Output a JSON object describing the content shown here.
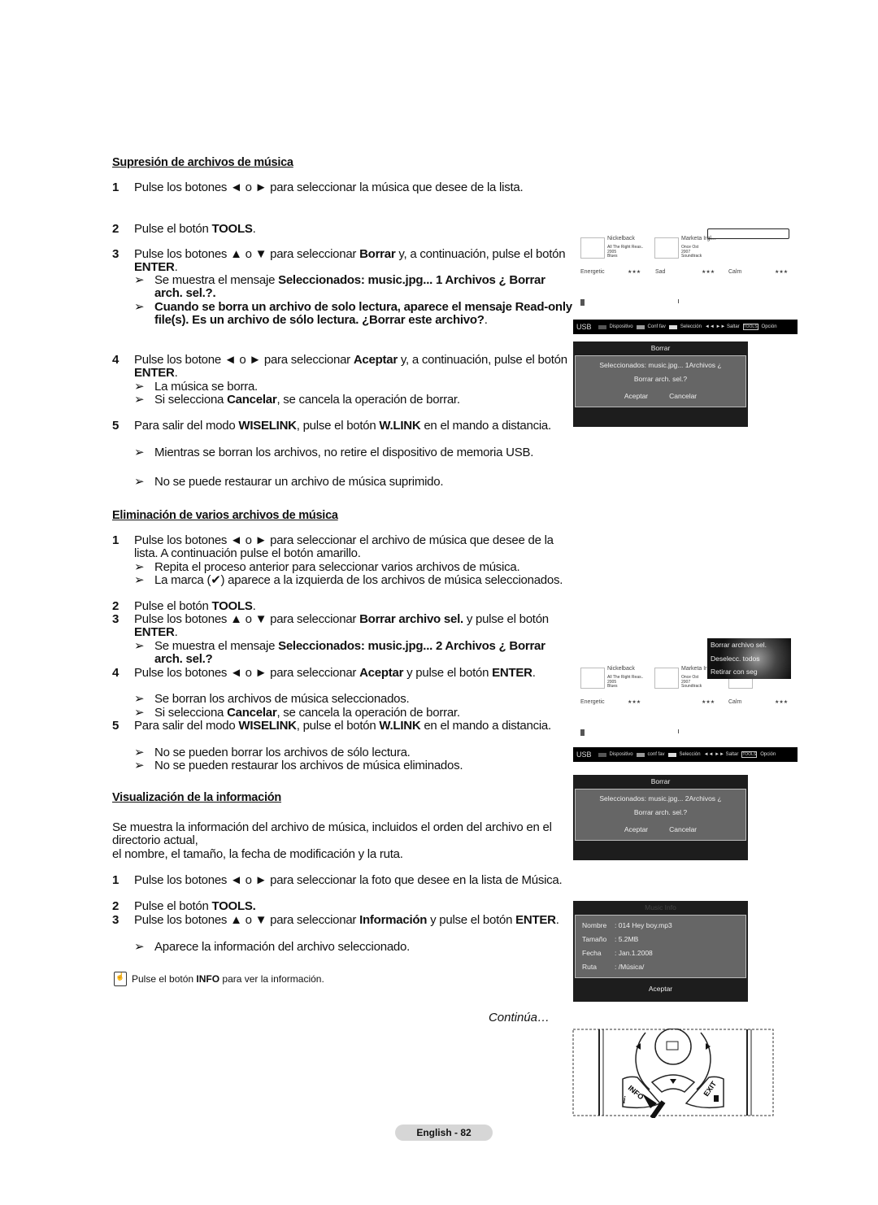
{
  "section1": {
    "title": "Supresión de archivos de música",
    "blocks": [
      {
        "type": "step",
        "num": "1",
        "parts": [
          [
            "Pulse los botones ◄ o ► para seleccionar la música que desee de la lista.",
            0
          ]
        ]
      },
      {
        "type": "step",
        "num": "2",
        "parts": [
          [
            "Pulse el botón ",
            0
          ],
          [
            "TOOLS",
            1
          ],
          [
            ".",
            0
          ]
        ]
      },
      {
        "type": "step",
        "num": "3",
        "parts": [
          [
            "Pulse los botones ▲ o ▼ para seleccionar ",
            0
          ],
          [
            "Borrar",
            1
          ],
          [
            " y, a continuación, pulse el botón ",
            0
          ],
          [
            "ENTER",
            1
          ],
          [
            ".",
            0
          ]
        ]
      },
      {
        "type": "note",
        "parts": [
          [
            "Se muestra el mensaje ",
            0
          ],
          [
            "Seleccionados: music.jpg... 1 Archivos ¿ Borrar arch. sel.?.",
            1
          ]
        ]
      },
      {
        "type": "note",
        "parts": [
          [
            "Cuando se borra un archivo de solo lectura, aparece el mensaje Read-only file(s). Es un archivo de sólo lectura. ¿Borrar este archivo?",
            1
          ],
          [
            ".",
            0
          ]
        ]
      },
      {
        "type": "step",
        "num": "4",
        "parts": [
          [
            "Pulse los botone ◄ o ► para seleccionar ",
            0
          ],
          [
            "Aceptar",
            1
          ],
          [
            " y, a continuación, pulse el botón ",
            0
          ],
          [
            "ENTER",
            1
          ],
          [
            ".",
            0
          ]
        ]
      },
      {
        "type": "note",
        "parts": [
          [
            "La música se borra.",
            0
          ]
        ]
      },
      {
        "type": "note",
        "parts": [
          [
            "Si selecciona ",
            0
          ],
          [
            "Cancelar",
            1
          ],
          [
            ", se cancela la operación de borrar.",
            0
          ]
        ]
      },
      {
        "type": "step",
        "num": "5",
        "parts": [
          [
            "Para salir del modo ",
            0
          ],
          [
            "WISELINK",
            1
          ],
          [
            ", pulse el botón ",
            0
          ],
          [
            "W.LINK",
            1
          ],
          [
            " en el mando a distancia.",
            0
          ]
        ]
      },
      {
        "type": "note",
        "parts": [
          [
            "Mientras se borran los archivos, no retire el dispositivo de memoria USB.",
            0
          ]
        ]
      },
      {
        "type": "note",
        "parts": [
          [
            "No se puede restaurar un archivo de música suprimido.",
            0
          ]
        ]
      }
    ]
  },
  "section2": {
    "title": "Eliminación de varios archivos de música",
    "blocks": [
      {
        "type": "step",
        "num": "1",
        "parts": [
          [
            "Pulse los botones ◄ o ► para seleccionar el archivo de música que desee de la lista. A continuación pulse el botón amarillo.",
            0
          ]
        ]
      },
      {
        "type": "note",
        "parts": [
          [
            "Repita el proceso anterior para seleccionar varios archivos de música.",
            0
          ]
        ]
      },
      {
        "type": "note",
        "parts": [
          [
            "La marca (✔) aparece a la izquierda de los archivos de música seleccionados.",
            0
          ]
        ]
      },
      {
        "type": "step",
        "num": "2",
        "parts": [
          [
            "Pulse el botón ",
            0
          ],
          [
            "TOOLS",
            1
          ],
          [
            ".",
            0
          ]
        ]
      },
      {
        "type": "step",
        "num": "3",
        "parts": [
          [
            "Pulse los botones ▲ o ▼ para seleccionar ",
            0
          ],
          [
            "Borrar archivo sel.",
            1
          ],
          [
            " y pulse el botón ",
            0
          ],
          [
            "ENTER",
            1
          ],
          [
            ".",
            0
          ]
        ]
      },
      {
        "type": "note",
        "parts": [
          [
            "Se muestra el mensaje ",
            0
          ],
          [
            "Seleccionados: music.jpg... 2 Archivos ¿ Borrar arch. sel.?",
            1
          ]
        ]
      },
      {
        "type": "step",
        "num": "4",
        "parts": [
          [
            "Pulse los botones ◄ o ► para seleccionar ",
            0
          ],
          [
            "Aceptar",
            1
          ],
          [
            " y pulse el botón ",
            0
          ],
          [
            "ENTER",
            1
          ],
          [
            ".",
            0
          ]
        ]
      },
      {
        "type": "note",
        "parts": [
          [
            "Se borran los archivos de música seleccionados.",
            0
          ]
        ]
      },
      {
        "type": "note",
        "parts": [
          [
            "Si selecciona ",
            0
          ],
          [
            "Cancelar",
            1
          ],
          [
            ", se cancela la operación de borrar.",
            0
          ]
        ]
      },
      {
        "type": "step",
        "num": "5",
        "parts": [
          [
            "Para salir del modo ",
            0
          ],
          [
            "WISELINK",
            1
          ],
          [
            ", pulse el botón ",
            0
          ],
          [
            "W.LINK",
            1
          ],
          [
            " en el mando a distancia.",
            0
          ]
        ]
      },
      {
        "type": "note",
        "parts": [
          [
            "No se pueden borrar los archivos de sólo lectura.",
            0
          ]
        ]
      },
      {
        "type": "note",
        "parts": [
          [
            "No se pueden restaurar los archivos de música eliminados.",
            0
          ]
        ]
      }
    ]
  },
  "section3": {
    "title": "Visualización de la información",
    "blocks": [
      {
        "type": "para",
        "parts": [
          [
            "Se muestra la información del archivo de música, incluidos el orden del archivo en el directorio actual,",
            0
          ]
        ]
      },
      {
        "type": "para",
        "parts": [
          [
            "el nombre, el tamaño, la fecha de modificación y la ruta.",
            0
          ]
        ]
      },
      {
        "type": "step",
        "num": "1",
        "parts": [
          [
            "Pulse los botones ◄ o ► para seleccionar la foto que desee en la lista de Música.",
            0
          ]
        ]
      },
      {
        "type": "step",
        "num": "2",
        "parts": [
          [
            "Pulse el botón ",
            0
          ],
          [
            "TOOLS.",
            1
          ]
        ]
      },
      {
        "type": "step",
        "num": "3",
        "parts": [
          [
            "Pulse los botones ▲ o ▼ para seleccionar ",
            0
          ],
          [
            "Información",
            1
          ],
          [
            " y pulse el botón ",
            0
          ],
          [
            "ENTER",
            1
          ],
          [
            ".",
            0
          ]
        ]
      },
      {
        "type": "note",
        "parts": [
          [
            "Aparece la información del archivo seleccionado.",
            0
          ]
        ]
      }
    ]
  },
  "info_note": {
    "pre": "Pulse el botón ",
    "bold": "INFO",
    "post": " para ver la información."
  },
  "continues": "Continúa…",
  "page_label": "English - 82",
  "screen1": {
    "albums": [
      {
        "artist": "Nickelback",
        "album": "All The Right Reas..",
        "year": "2005",
        "genre": "Blues"
      },
      {
        "artist": "Marketa Irgl...",
        "album": "Once Ost",
        "year": "2007",
        "genre": "Soundtrack"
      }
    ],
    "moods": [
      "Energetic",
      "Sad",
      "Calm"
    ],
    "stars": "★★★",
    "band": {
      "usb": "USB",
      "dev": "Dispositivo",
      "fav": "Conf fav",
      "sel": "Selección",
      "skip": "◄◄ ►► Saltar",
      "tools": "TOOLS",
      "opt": "Opción"
    },
    "dialog": {
      "title": "Borrar",
      "line1": "Seleccionados: music.jpg... 1Archivos ¿",
      "line2": "Borrar arch. sel.?",
      "ok": "Aceptar",
      "cancel": "Cancelar"
    }
  },
  "screen2": {
    "menu": [
      "Borrar archivo sel.",
      "Deselecc. todos",
      "Retirar con seg"
    ],
    "albums": [
      {
        "artist": "Nickelback",
        "album": "All The Right Reas..",
        "year": "2005",
        "genre": "Blues"
      },
      {
        "artist": "Marketa Ir",
        "album": "Once Ost",
        "year": "2007",
        "genre": "Soundtrack"
      }
    ],
    "moods": [
      "Energetic",
      "",
      "Calm"
    ],
    "stars": "★★★",
    "band": {
      "usb": "USB",
      "dev": "Dispositivo",
      "fav": "conf fav",
      "sel": "Selección",
      "skip": "◄◄ ►► Saltar",
      "tools": "TOOLS",
      "opt": "Opción"
    },
    "dialog": {
      "title": "Borrar",
      "line1": "Seleccionados: music.jpg... 2Archivos ¿",
      "line2": "Borrar arch. sel.?",
      "ok": "Aceptar",
      "cancel": "Cancelar"
    }
  },
  "music_info": {
    "title": "Music Info",
    "rows": [
      [
        "Nombre",
        ": 014 Hey boy.mp3"
      ],
      [
        "Tamaño",
        ": 5.2MB"
      ],
      [
        "Fecha",
        ": Jan.1.2008"
      ],
      [
        "Ruta",
        ": /Música/"
      ]
    ],
    "ok": "Aceptar"
  },
  "remote": {
    "info": "INFO",
    "exit": "EXIT"
  },
  "colors": {
    "dialog_bg": "#1d1d1d",
    "dialog_inner": "#666666",
    "band": "#000000",
    "page_pill": "#d6d6d6"
  }
}
